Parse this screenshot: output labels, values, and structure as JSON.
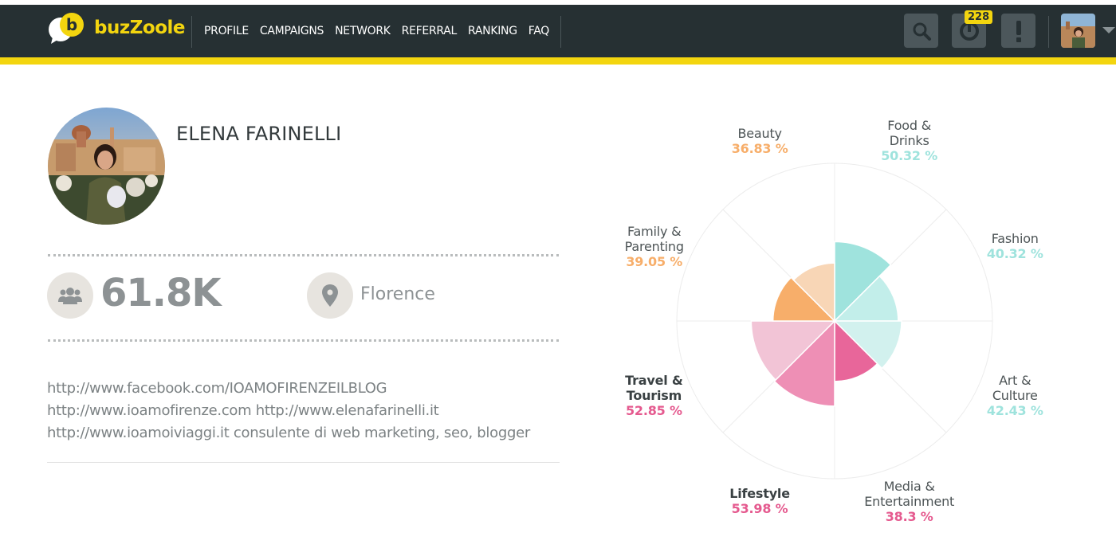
{
  "app": {
    "logo_text": "buzZoole",
    "notification_count": "228"
  },
  "nav": {
    "items": [
      "PROFILE",
      "CAMPAIGNS",
      "NETWORK",
      "REFERRAL",
      "RANKING",
      "FAQ"
    ]
  },
  "colors": {
    "navbar_bg": "#263033",
    "accent_yellow": "#f3d50f",
    "teal": "#9fe3dd",
    "orange": "#f7ae6a",
    "pink": "#e86b9a"
  },
  "profile": {
    "name": "ELENA FARINELLI",
    "followers": "61.8K",
    "location": "Florence",
    "bio_lines": [
      "http://www.facebook.com/IOAMOFIRENZEILBLOG",
      "http://www.ioamofirenze.com http://www.elenafarinelli.it",
      "http://www.ioamoiviaggi.it consulente di web marketing, seo, blogger"
    ]
  },
  "chart_data": {
    "type": "polar-area",
    "categories": [
      "Food & Drinks",
      "Fashion",
      "Art & Culture",
      "Media & Entertainment",
      "Lifestyle",
      "Travel & Tourism",
      "Family & Parenting",
      "Beauty"
    ],
    "values": [
      50.32,
      40.32,
      42.43,
      38.3,
      53.98,
      52.85,
      39.05,
      36.83
    ],
    "value_labels": [
      "50.32 %",
      "40.32 %",
      "42.43 %",
      "38.3 %",
      "53.98 %",
      "52.85 %",
      "39.05 %",
      "36.83 %"
    ],
    "label_lines": [
      [
        "Food &",
        "Drinks"
      ],
      [
        "Fashion"
      ],
      [
        "Art &",
        "Culture"
      ],
      [
        "Media &",
        "Entertainment"
      ],
      [
        "Lifestyle"
      ],
      [
        "Travel &",
        "Tourism"
      ],
      [
        "Family &",
        "Parenting"
      ],
      [
        "Beauty"
      ]
    ],
    "colors": [
      "#9fe3dd",
      "#c2eeea",
      "#d2f1ee",
      "#e8669a",
      "#ee8fb5",
      "#f2c4d6",
      "#f7ae6a",
      "#f8d6b6"
    ],
    "label_colors": [
      "#9fe3dd",
      "#9fe3dd",
      "#9fe3dd",
      "#e55a8f",
      "#e55a8f",
      "#e55a8f",
      "#f7ae6a",
      "#f7ae6a"
    ],
    "bold_labels": [
      false,
      false,
      false,
      false,
      true,
      true,
      false,
      false
    ],
    "rmax": 100
  }
}
